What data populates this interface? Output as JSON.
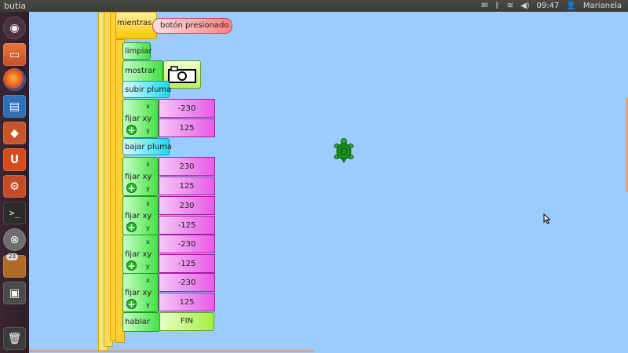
{
  "topbar": {
    "title": "butia",
    "time": "09:47",
    "user": "Marianela",
    "icons": [
      "mail-icon",
      "bluetooth-icon",
      "wifi-icon",
      "volume-icon",
      "user-icon"
    ]
  },
  "launcher": {
    "items": [
      {
        "name": "ubuntu-home",
        "icon": "ubuntu-logo-icon"
      },
      {
        "name": "files",
        "icon": "folder-icon"
      },
      {
        "name": "firefox",
        "icon": "firefox-icon"
      },
      {
        "name": "writer",
        "icon": "document-icon"
      },
      {
        "name": "software-center",
        "icon": "shopping-bag-icon"
      },
      {
        "name": "ubuntu-one",
        "icon": "ubuntu-one-icon"
      },
      {
        "name": "settings",
        "icon": "gear-icon"
      },
      {
        "name": "terminal",
        "icon": "terminal-icon"
      },
      {
        "name": "butia",
        "icon": "xo-icon"
      },
      {
        "name": "turtleart",
        "icon": "turtle-app-icon",
        "badge": "23"
      },
      {
        "name": "workspaces",
        "icon": "workspace-icon"
      },
      {
        "name": "trash",
        "icon": "trash-icon"
      }
    ]
  },
  "program": {
    "while_label": "mientras",
    "while_condition": "botón presionado",
    "clear_label": "limpiar",
    "show_label": "mostrar",
    "pen_up_label": "subir pluma",
    "setxy_label": "fijar xy",
    "x_label": "x",
    "y_label": "y",
    "pen_down_label": "bajar pluma",
    "speak_label": "hablar",
    "speak_text": "FIN",
    "setxy": [
      {
        "x": "-230",
        "y": "125"
      },
      {
        "x": "230",
        "y": "125"
      },
      {
        "x": "230",
        "y": "-125"
      },
      {
        "x": "-230",
        "y": "-125"
      },
      {
        "x": "-230",
        "y": "125"
      }
    ]
  },
  "colors": {
    "canvas": "#9ccbff",
    "flow_block": "#ffc800",
    "turtle_block": "#44ff44",
    "pen_block": "#00e0ff",
    "number_block": "#ff00ff",
    "turtle": "#1a8c1a"
  }
}
